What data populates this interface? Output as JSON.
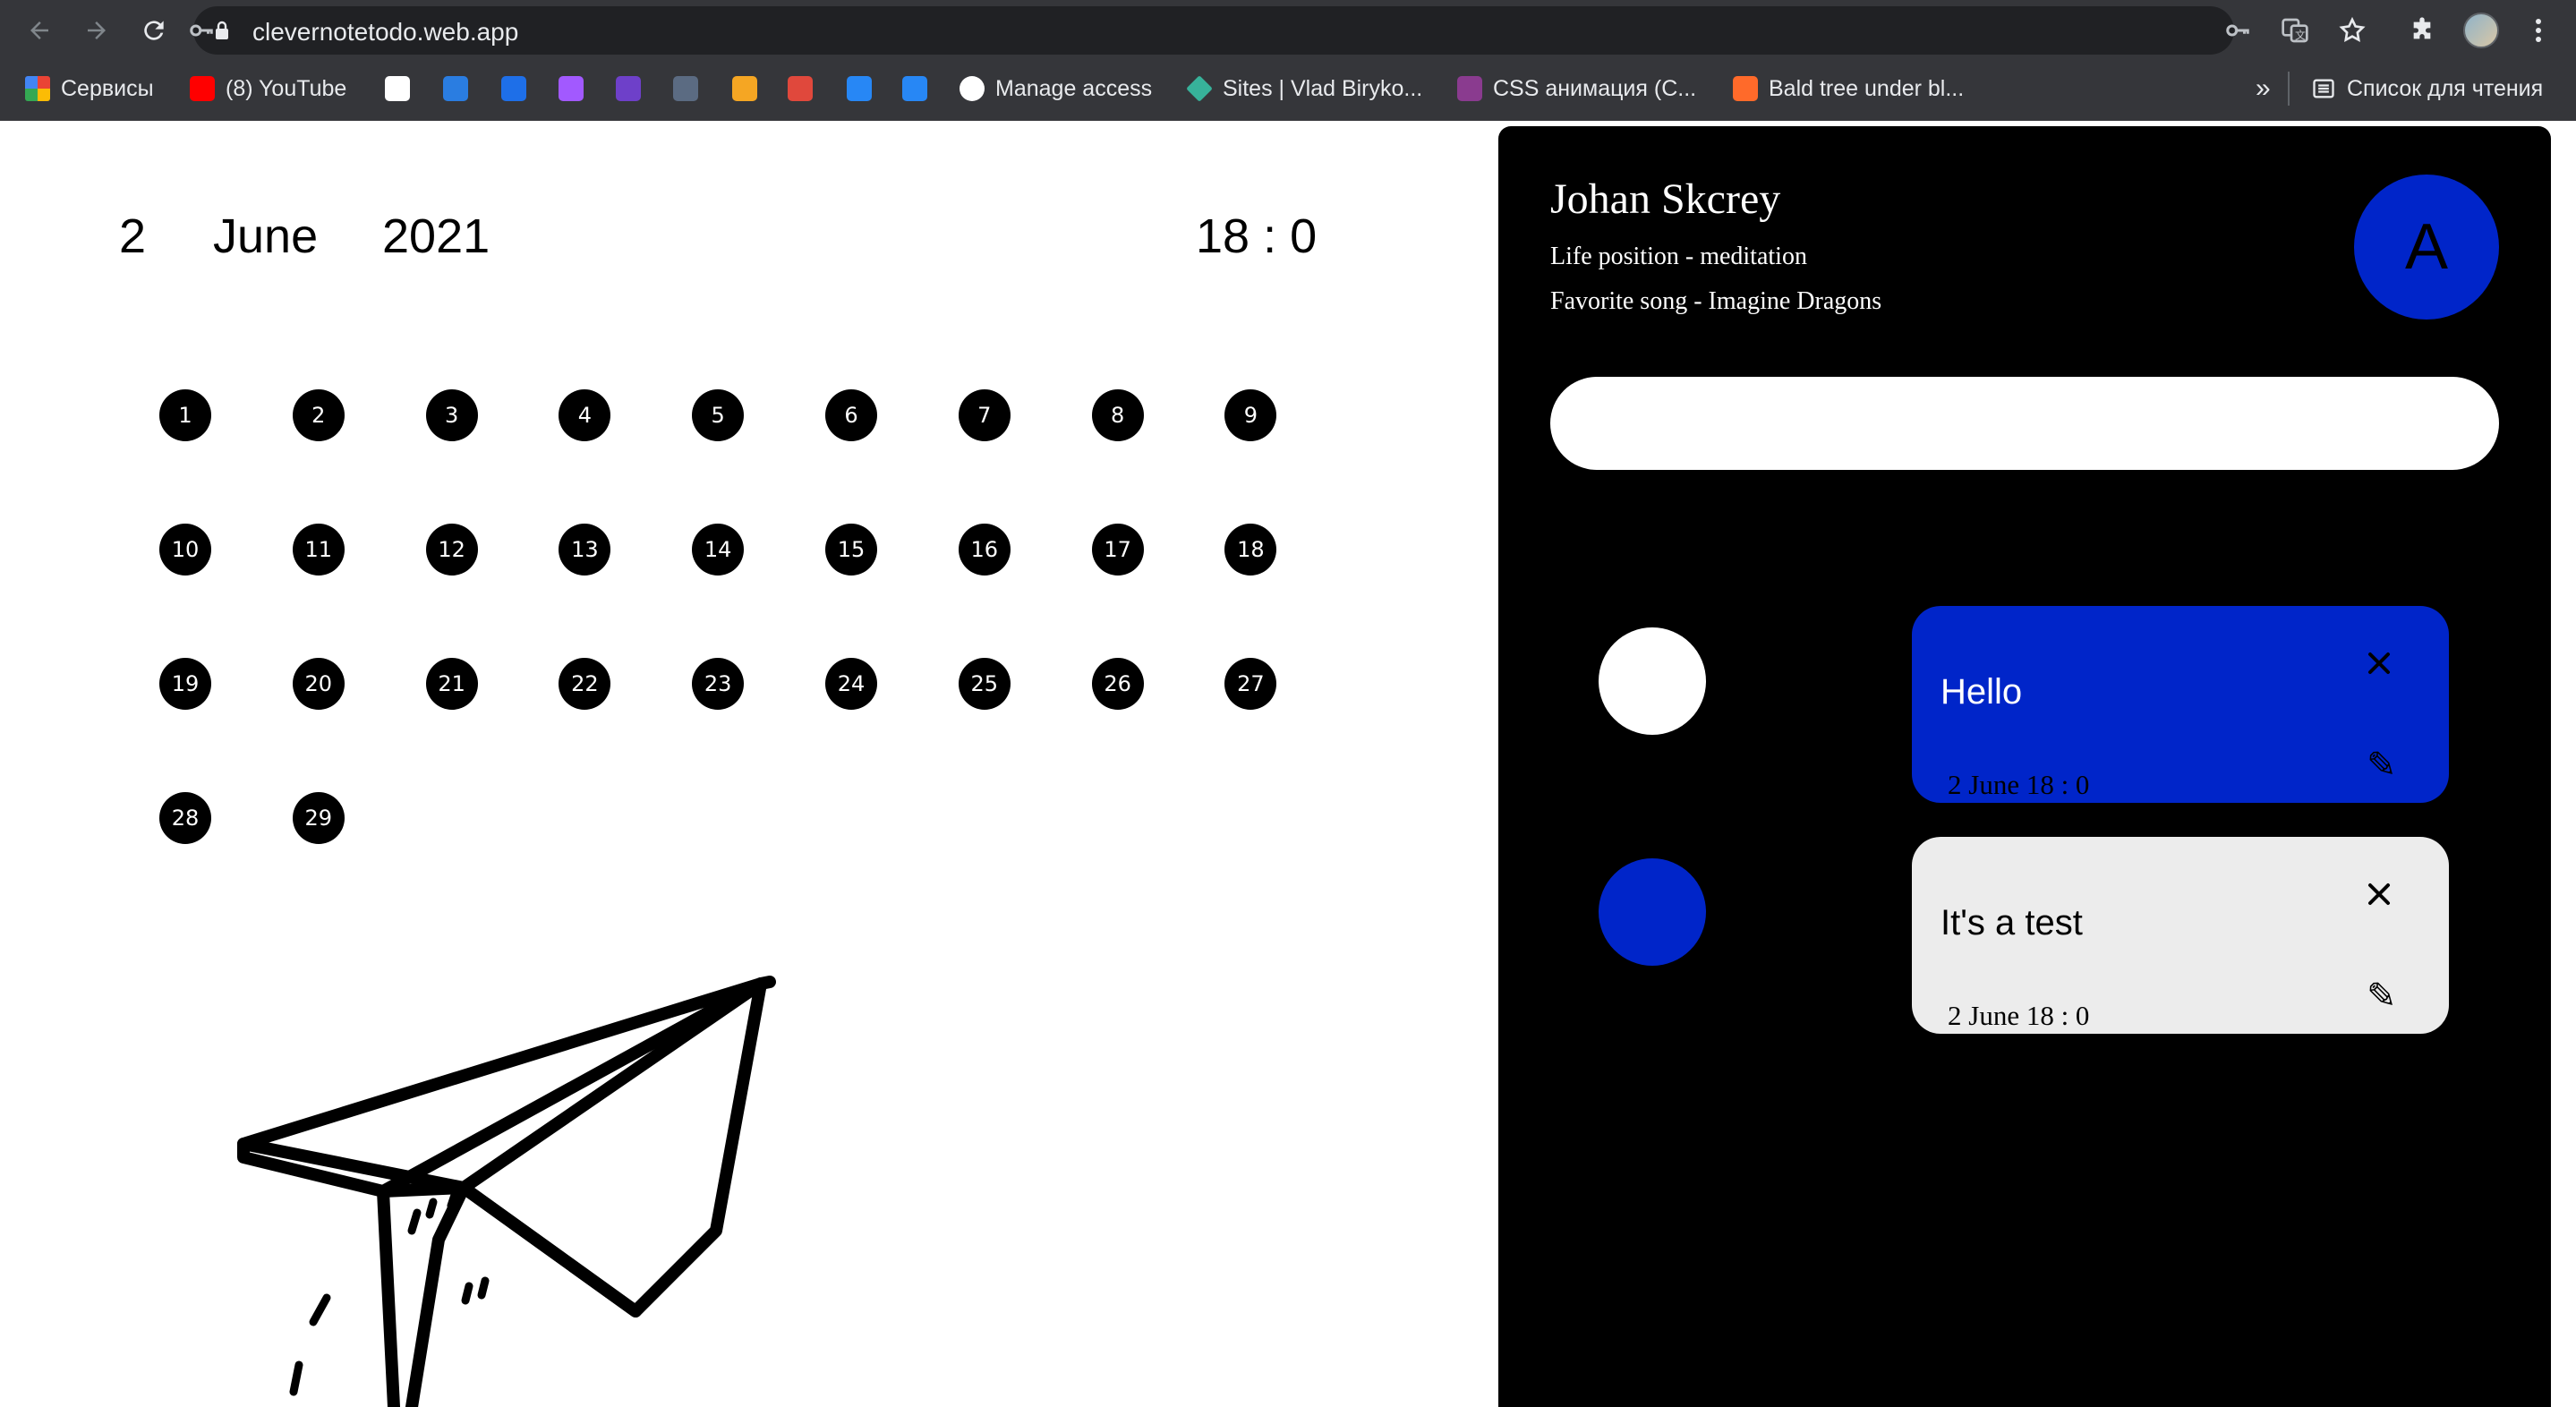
{
  "browser": {
    "url": "clevernotetodo.web.app",
    "bookmarks": [
      {
        "label": "Сервисы",
        "icon": "apps-grid-icon",
        "color": "#ea4335"
      },
      {
        "label": "(8) YouTube",
        "icon": "youtube-icon",
        "color": "#ff0000"
      },
      {
        "label": "",
        "icon": "wix-icon",
        "color": "#ffffff"
      },
      {
        "label": "",
        "icon": "stackoverflow-icon",
        "color": "#2a7de1"
      },
      {
        "label": "",
        "icon": "puzzle-blue-icon",
        "color": "#1e6fe8"
      },
      {
        "label": "",
        "icon": "figma-icon",
        "color": "#a259ff"
      },
      {
        "label": "",
        "icon": "github-desktop-icon",
        "color": "#6e40c9"
      },
      {
        "label": "",
        "icon": "blob-icon",
        "color": "#5b6b82"
      },
      {
        "label": "",
        "icon": "bolt-icon",
        "color": "#f5a623"
      },
      {
        "label": "",
        "icon": "nsu-icon",
        "color": "#e0483c"
      },
      {
        "label": "",
        "icon": "vk-icon",
        "color": "#2787f5"
      },
      {
        "label": "",
        "icon": "vk-icon-2",
        "color": "#2787f5"
      },
      {
        "label": "Manage access",
        "icon": "github-icon",
        "color": "#ffffff"
      },
      {
        "label": "Sites | Vlad Biryko...",
        "icon": "sites-diamond-icon",
        "color": "#37b29a"
      },
      {
        "label": "CSS анимация (С...",
        "icon": "css-book-icon",
        "color": "#8a3b8f"
      },
      {
        "label": "Bald tree under bl...",
        "icon": "flame-icon",
        "color": "#ff6a2a"
      }
    ],
    "overflow_label": "»",
    "reading_list_label": "Список для чтения"
  },
  "date": {
    "day": "2",
    "month": "June",
    "year": "2021",
    "time": "18 : 0"
  },
  "calendar": {
    "days": [
      "1",
      "2",
      "3",
      "4",
      "5",
      "6",
      "7",
      "8",
      "9",
      "10",
      "11",
      "12",
      "13",
      "14",
      "15",
      "16",
      "17",
      "18",
      "19",
      "20",
      "21",
      "22",
      "23",
      "24",
      "25",
      "26",
      "27",
      "28",
      "29"
    ]
  },
  "profile": {
    "name": "Johan Skcrey",
    "life_position": "Life position - meditation",
    "favorite_song": "Favorite song - Imagine Dragons",
    "avatar_letter": "A"
  },
  "note_input": {
    "value": ""
  },
  "notes": [
    {
      "title": "Hello",
      "date": "2 June 18 : 0",
      "close": "×",
      "edit": "✎",
      "card_color": "#0025c9",
      "dot_color": "#ffffff"
    },
    {
      "title": "It's a test",
      "date": "2 June 18 : 0",
      "close": "×",
      "edit": "✎",
      "card_color": "#ececec",
      "dot_color": "#0025c9"
    }
  ],
  "colors": {
    "accent_blue": "#0025c9",
    "panel_bg": "#000000",
    "chrome_bg": "#35363a"
  }
}
